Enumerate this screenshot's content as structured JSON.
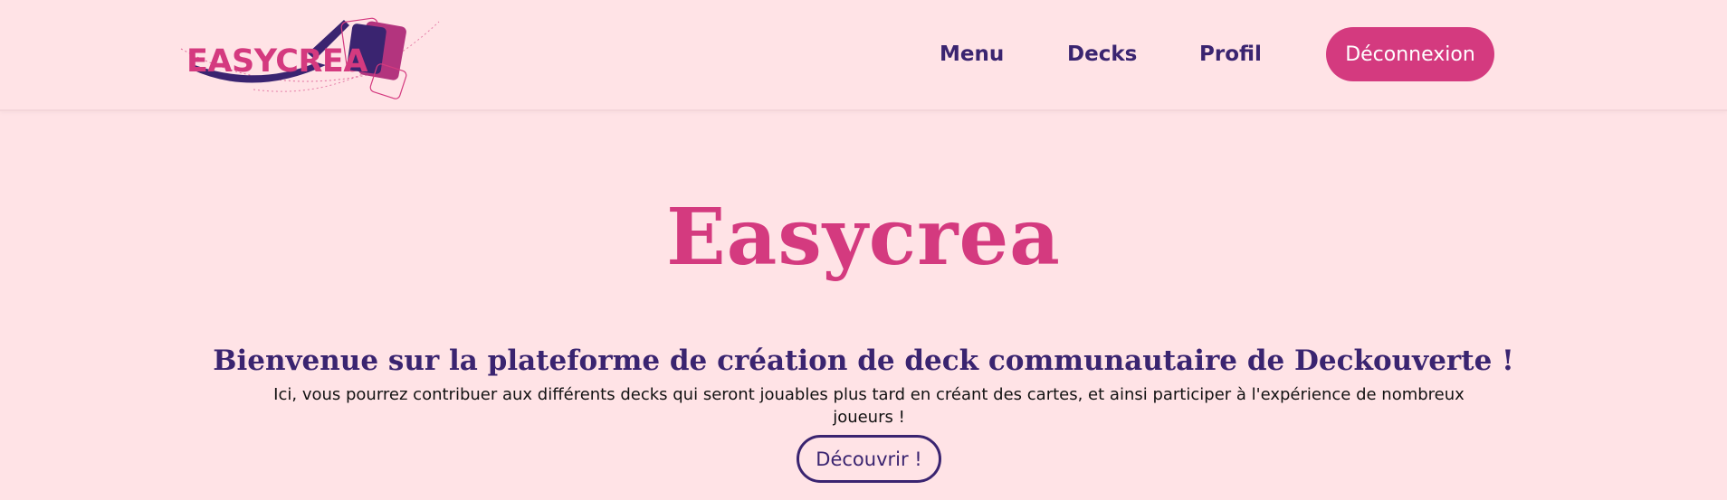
{
  "brand": {
    "logo_text": "EASYCREA",
    "colors": {
      "primary": "#d43a7f",
      "secondary": "#3a2470",
      "background": "#ffe3e6"
    }
  },
  "nav": {
    "items": [
      {
        "label": "Menu"
      },
      {
        "label": "Decks"
      },
      {
        "label": "Profil"
      }
    ],
    "logout_label": "Déconnexion"
  },
  "hero": {
    "title": "Easycrea",
    "subtitle": "Bienvenue sur la plateforme de création de deck communautaire de Deckouverte !",
    "description": "Ici, vous pourrez contribuer aux différents decks qui seront jouables plus tard en créant des cartes, et ainsi participer à l'expérience de nombreux joueurs !",
    "cta_label": "Découvrir !"
  }
}
